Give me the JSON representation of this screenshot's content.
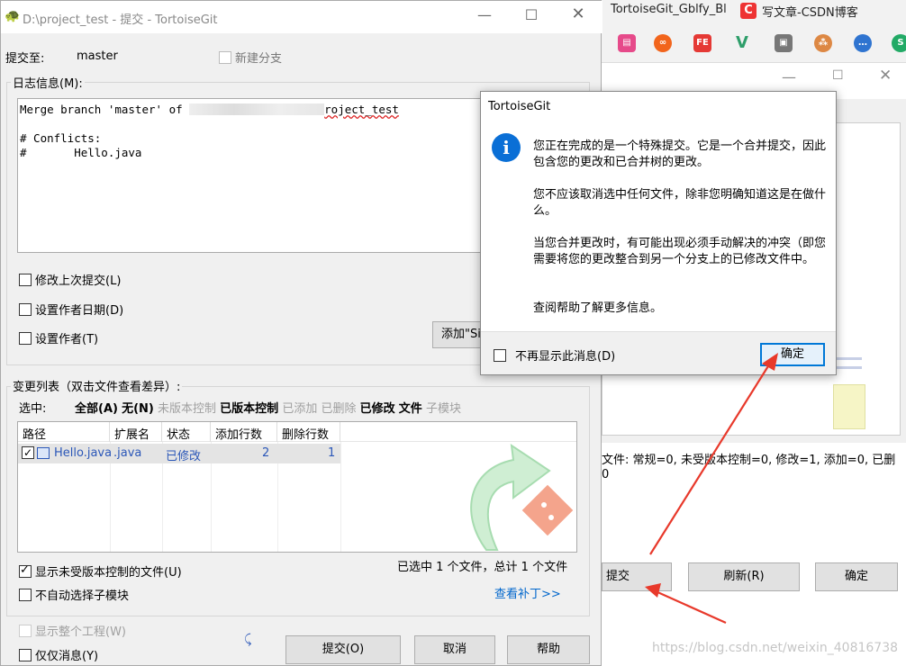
{
  "browser": {
    "tabs": [
      "TortoiseGit_Gblfy_Bl",
      "写文章-CSDN博客"
    ],
    "csdn_badge": "C"
  },
  "main_window": {
    "title": "D:\\project_test - 提交 - TortoiseGit",
    "commit_to_label": "提交至:",
    "branch": "master",
    "new_branch_label": "新建分支",
    "log_message_label": "日志信息(M):",
    "message_lines": [
      "Merge branch 'master' of ",
      "roject_test",
      "",
      "# Conflicts:",
      "#       Hello.java"
    ],
    "amend_label": "修改上次提交(L)",
    "set_author_date_label": "设置作者日期(D)",
    "set_author_label": "设置作者(T)",
    "add_signed_button": "添加\"Si",
    "changes_label": "变更列表（双击文件查看差异）:",
    "select_label": "选中:",
    "filters": [
      {
        "label": "全部(A)",
        "style": "bold"
      },
      {
        "label": "无(N)",
        "style": "bold"
      },
      {
        "label": "未版本控制",
        "style": "dim"
      },
      {
        "label": "已版本控制",
        "style": "bold"
      },
      {
        "label": "已添加",
        "style": "dim"
      },
      {
        "label": "已删除",
        "style": "dim"
      },
      {
        "label": "已修改",
        "style": "bold"
      },
      {
        "label": "文件",
        "style": "bold"
      },
      {
        "label": "子模块",
        "style": "dim"
      }
    ],
    "columns": [
      "路径",
      "扩展名",
      "状态",
      "添加行数",
      "删除行数"
    ],
    "file_row": {
      "path": "Hello.java",
      "ext": ".java",
      "status": "已修改",
      "added": "2",
      "deleted": "1"
    },
    "show_unversioned_label": "显示未受版本控制的文件(U)",
    "no_auto_submodule_label": "不自动选择子模块",
    "selection_summary": "已选中 1 个文件，总计 1 个文件",
    "view_patch_link": "查看补丁>>",
    "show_whole_project_label": "显示整个工程(W)",
    "message_only_label": "仅仅消息(Y)",
    "commit_button": "提交(O)",
    "cancel_button": "取消",
    "help_button": "帮助"
  },
  "bg_window": {
    "status_line1": "文件: 常规=0, 未受版本控制=0, 修改=1, 添加=0, 已删",
    "status_line2": "0",
    "commit_button": "提交",
    "refresh_button": "刷新(R)",
    "ok_button": "确定"
  },
  "dialog": {
    "title": "TortoiseGit",
    "para1": "您正在完成的是一个特殊提交。它是一个合并提交，因此包含您的更改和已合并树的更改。",
    "para2": "您不应该取消选中任何文件，除非您明确知道这是在做什么。",
    "para3": "当您合并更改时，有可能出现必须手动解决的冲突（即您需要将您的更改整合到另一个分支上的已修改文件中。",
    "para4": "查阅帮助了解更多信息。",
    "dont_show_label": "不再显示此消息(D)",
    "ok_button": "确定"
  },
  "watermark": "https://blog.csdn.net/weixin_40816738",
  "colors": {
    "accent_red": "#e8392b",
    "info_blue": "#0a6fd6",
    "link_blue": "#0066cc",
    "modified_blue": "#2b57b8"
  }
}
